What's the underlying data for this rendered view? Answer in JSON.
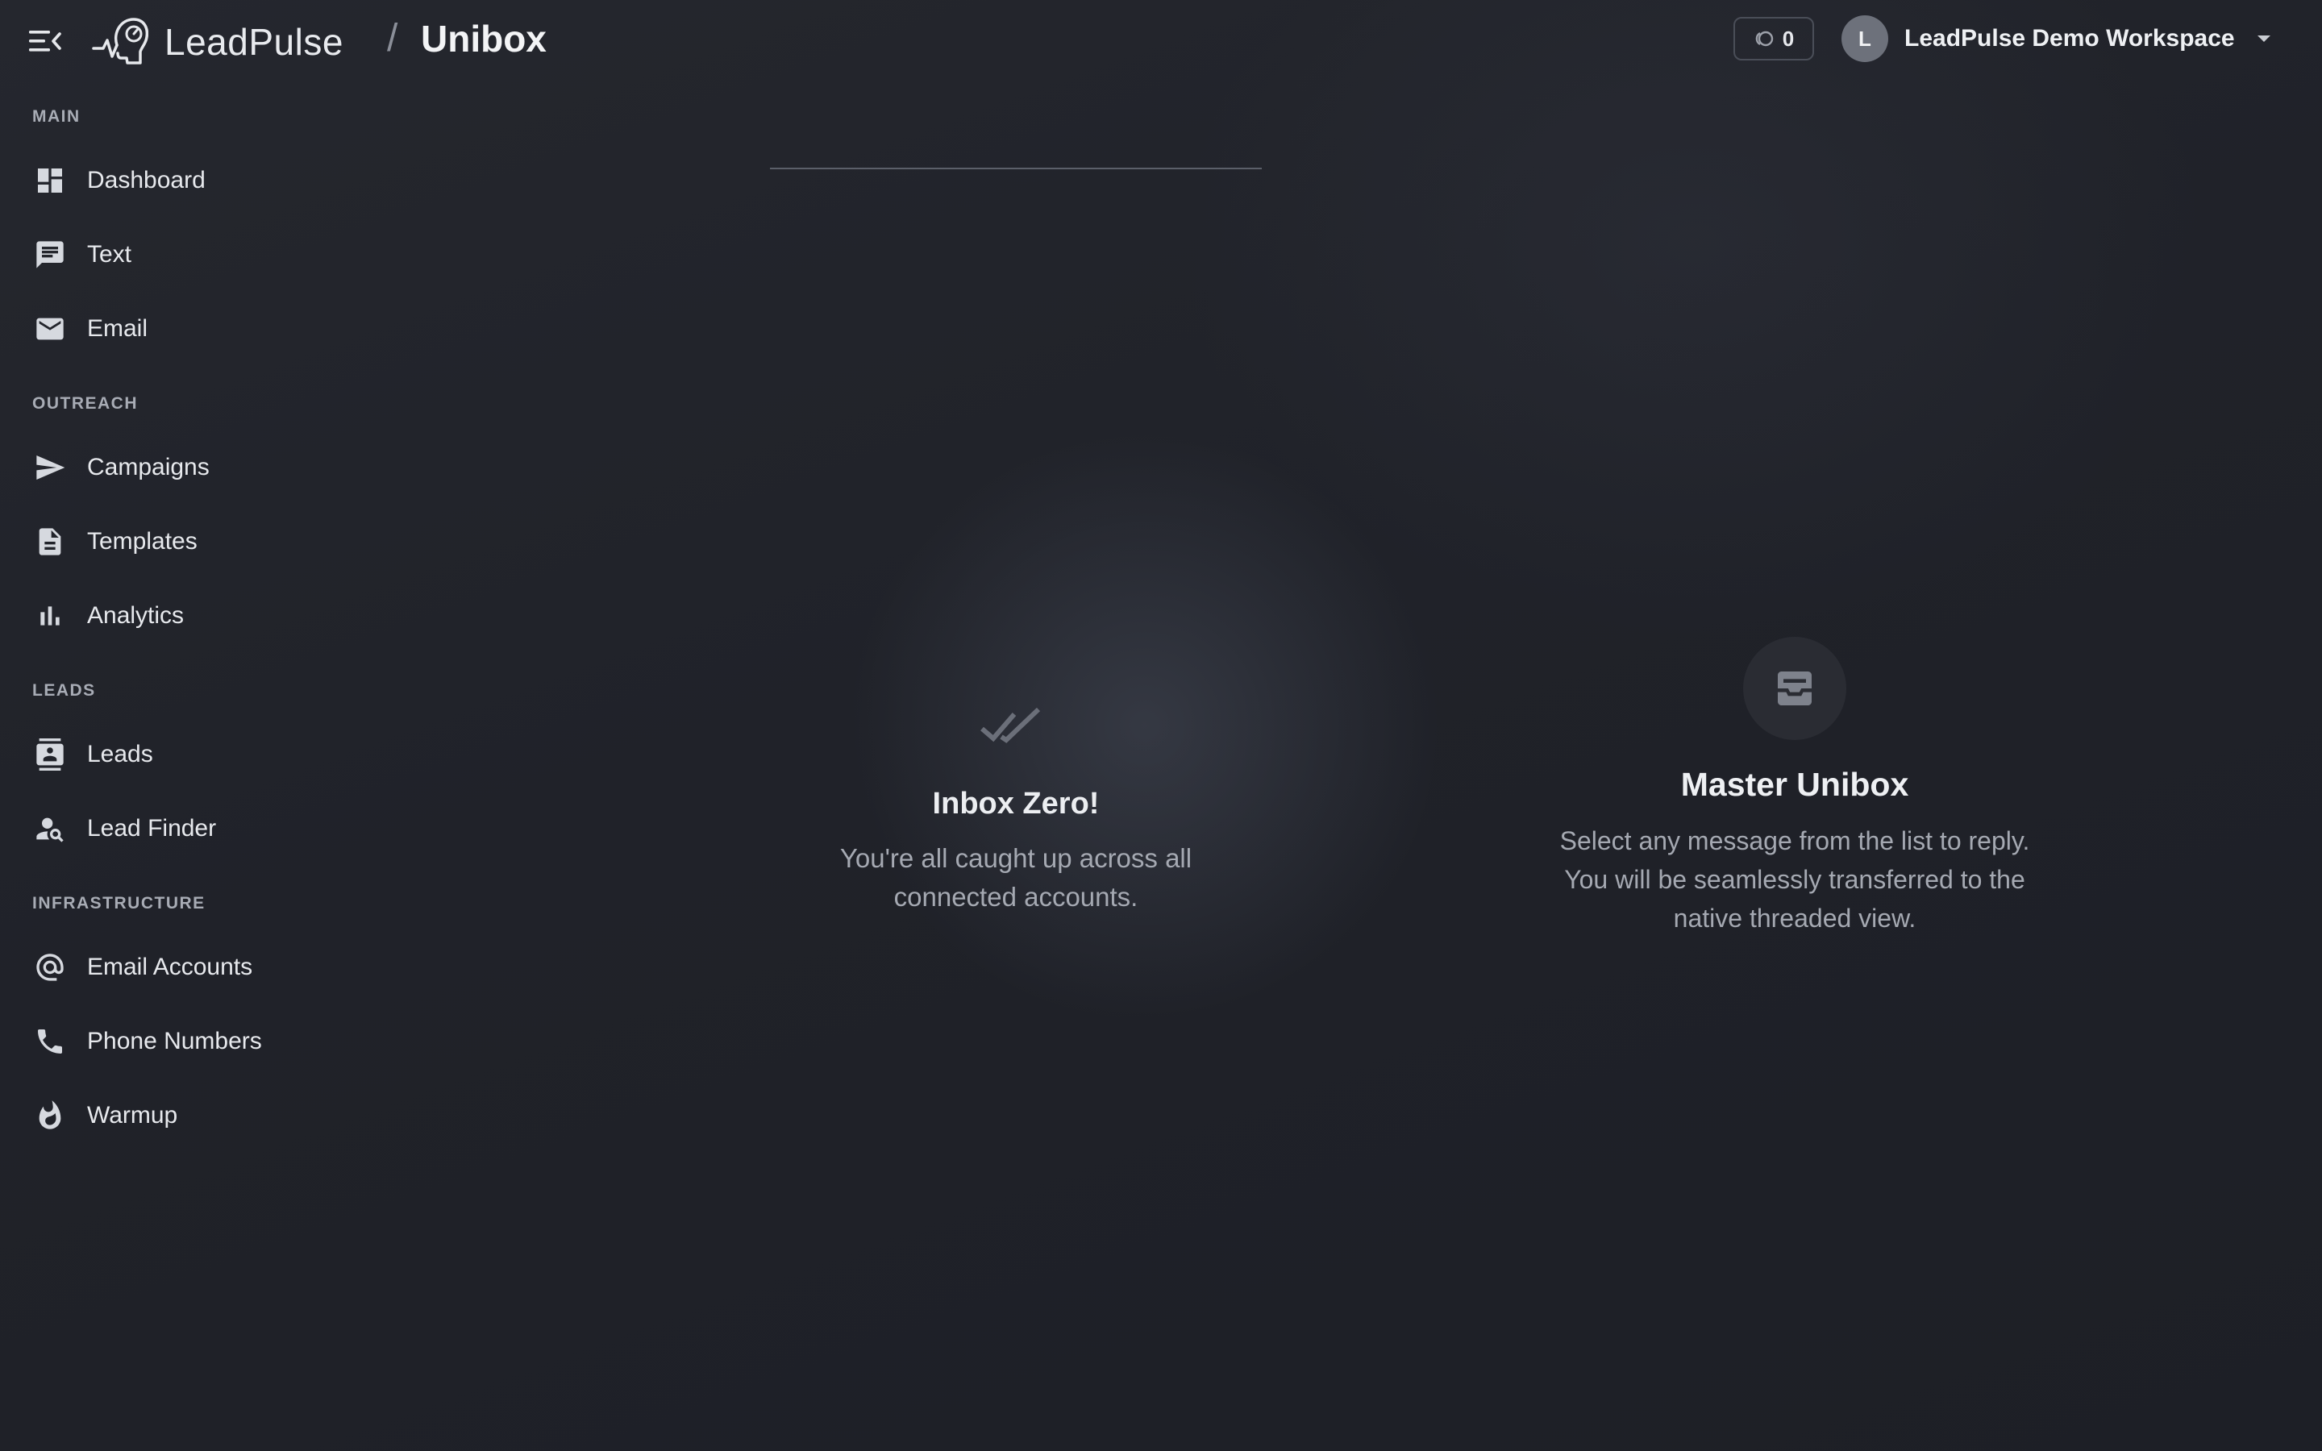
{
  "header": {
    "brand": "LeadPulse",
    "separator": "/",
    "page_title": "Unibox",
    "credits_count": "0",
    "workspace_initial": "L",
    "workspace_name": "LeadPulse Demo Workspace"
  },
  "sidebar": {
    "sections": [
      {
        "title": "MAIN"
      },
      {
        "title": "OUTREACH"
      },
      {
        "title": "LEADS"
      },
      {
        "title": "INFRASTRUCTURE"
      }
    ],
    "items": [
      {
        "label": "Dashboard",
        "icon": "dashboard-icon"
      },
      {
        "label": "Text",
        "icon": "chat-icon"
      },
      {
        "label": "Email",
        "icon": "mail-icon"
      },
      {
        "label": "Campaigns",
        "icon": "send-icon"
      },
      {
        "label": "Templates",
        "icon": "document-icon"
      },
      {
        "label": "Analytics",
        "icon": "bar-chart-icon"
      },
      {
        "label": "Leads",
        "icon": "contacts-icon"
      },
      {
        "label": "Lead Finder",
        "icon": "person-search-icon"
      },
      {
        "label": "Email Accounts",
        "icon": "at-sign-icon"
      },
      {
        "label": "Phone Numbers",
        "icon": "phone-icon"
      },
      {
        "label": "Warmup",
        "icon": "flame-icon"
      }
    ]
  },
  "inbox": {
    "empty_title": "Inbox Zero!",
    "empty_text": "You're all caught up across all connected accounts."
  },
  "detail": {
    "title": "Master Unibox",
    "text": "Select any message from the list to reply. You will be seamlessly transferred to the native threaded view."
  },
  "colors": {
    "background": "#202229",
    "text_primary": "#e6e8ec",
    "text_muted": "#a5a9b2",
    "section_title": "#a8acb5"
  }
}
